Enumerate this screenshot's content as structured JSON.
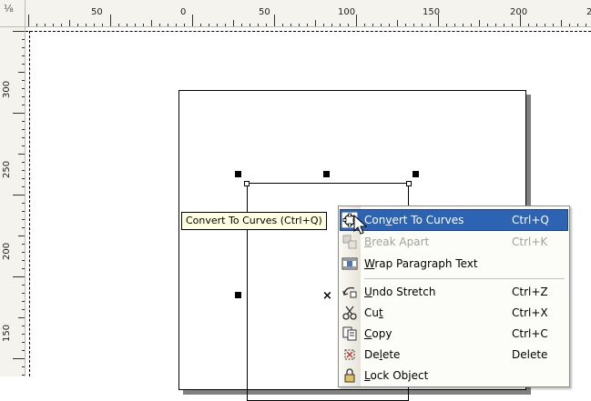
{
  "ruler": {
    "corner_symbol": "⅛",
    "h_labels": [
      "50",
      "0",
      "50",
      "100",
      "150",
      "200",
      "2"
    ],
    "v_labels": [
      "300",
      "250",
      "200",
      "150"
    ]
  },
  "tooltip": {
    "text": "Convert To Curves (Ctrl+Q)"
  },
  "context_menu": {
    "items": [
      {
        "label_pre": "Con",
        "label_u": "v",
        "label_post": "ert To Curves",
        "shortcut": "Ctrl+Q",
        "icon": "convert-curves-icon",
        "state": "highlighted"
      },
      {
        "label_pre": "",
        "label_u": "B",
        "label_post": "reak  Apart",
        "shortcut": "Ctrl+K",
        "icon": "break-apart-icon",
        "state": "disabled"
      },
      {
        "label_pre": "",
        "label_u": "W",
        "label_post": "rap Paragraph Text",
        "shortcut": "",
        "icon": "wrap-text-icon",
        "state": "normal"
      },
      {
        "label_pre": "",
        "label_u": "U",
        "label_post": "ndo Stretch",
        "shortcut": "Ctrl+Z",
        "icon": "undo-icon",
        "state": "normal"
      },
      {
        "label_pre": "Cu",
        "label_u": "t",
        "label_post": "",
        "shortcut": "Ctrl+X",
        "icon": "scissors-icon",
        "state": "normal"
      },
      {
        "label_pre": "",
        "label_u": "C",
        "label_post": "opy",
        "shortcut": "Ctrl+C",
        "icon": "copy-icon",
        "state": "normal"
      },
      {
        "label_pre": "De",
        "label_u": "l",
        "label_post": "ete",
        "shortcut": "Delete",
        "icon": "delete-icon",
        "state": "normal"
      },
      {
        "label_pre": "",
        "label_u": "L",
        "label_post": "ock Object",
        "shortcut": "",
        "icon": "lock-icon",
        "state": "normal"
      }
    ]
  },
  "colors": {
    "highlight": "#2d63b3",
    "tooltip_bg": "#ffffe1",
    "ruler_bg": "#f4f3ee"
  }
}
